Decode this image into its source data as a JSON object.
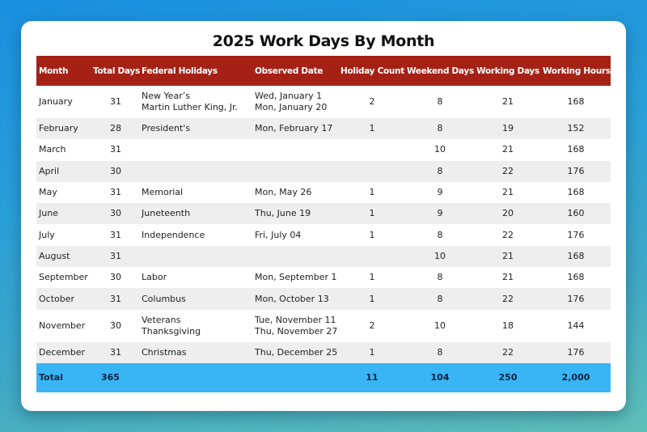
{
  "title": "2025 Work Days By Month",
  "colors": {
    "header_bg": "#a52116",
    "total_bg": "#39b5f5",
    "stripe_bg": "#eeeeee"
  },
  "columns": [
    "Month",
    "Total Days",
    "Federal Holidays",
    "Observed Date",
    "Holiday Count",
    "Weekend Days",
    "Working Days",
    "Working Hours"
  ],
  "rows": [
    {
      "month": "January",
      "total_days": "31",
      "holidays": [
        "New Year’s",
        "Martin Luther King, Jr."
      ],
      "dates": [
        "Wed, January 1",
        "Mon, January 20"
      ],
      "holiday_count": "2",
      "weekend_days": "8",
      "working_days": "21",
      "working_hours": "168"
    },
    {
      "month": "February",
      "total_days": "28",
      "holidays": [
        "President's"
      ],
      "dates": [
        "Mon, February 17"
      ],
      "holiday_count": "1",
      "weekend_days": "8",
      "working_days": "19",
      "working_hours": "152"
    },
    {
      "month": "March",
      "total_days": "31",
      "holidays": [],
      "dates": [],
      "holiday_count": "",
      "weekend_days": "10",
      "working_days": "21",
      "working_hours": "168"
    },
    {
      "month": "April",
      "total_days": "30",
      "holidays": [],
      "dates": [],
      "holiday_count": "",
      "weekend_days": "8",
      "working_days": "22",
      "working_hours": "176"
    },
    {
      "month": "May",
      "total_days": "31",
      "holidays": [
        "Memorial"
      ],
      "dates": [
        "Mon, May 26"
      ],
      "holiday_count": "1",
      "weekend_days": "9",
      "working_days": "21",
      "working_hours": "168"
    },
    {
      "month": "June",
      "total_days": "30",
      "holidays": [
        "Juneteenth"
      ],
      "dates": [
        "Thu, June 19"
      ],
      "holiday_count": "1",
      "weekend_days": "9",
      "working_days": "20",
      "working_hours": "160"
    },
    {
      "month": "July",
      "total_days": "31",
      "holidays": [
        "Independence"
      ],
      "dates": [
        "Fri, July 04"
      ],
      "holiday_count": "1",
      "weekend_days": "8",
      "working_days": "22",
      "working_hours": "176"
    },
    {
      "month": "August",
      "total_days": "31",
      "holidays": [],
      "dates": [],
      "holiday_count": "",
      "weekend_days": "10",
      "working_days": "21",
      "working_hours": "168"
    },
    {
      "month": "September",
      "total_days": "30",
      "holidays": [
        "Labor"
      ],
      "dates": [
        "Mon, September 1"
      ],
      "holiday_count": "1",
      "weekend_days": "8",
      "working_days": "21",
      "working_hours": "168"
    },
    {
      "month": "October",
      "total_days": "31",
      "holidays": [
        "Columbus"
      ],
      "dates": [
        "Mon, October 13"
      ],
      "holiday_count": "1",
      "weekend_days": "8",
      "working_days": "22",
      "working_hours": "176"
    },
    {
      "month": "November",
      "total_days": "30",
      "holidays": [
        "Veterans",
        "Thanksgiving"
      ],
      "dates": [
        "Tue, November 11",
        "Thu, November 27"
      ],
      "holiday_count": "2",
      "weekend_days": "10",
      "working_days": "18",
      "working_hours": "144"
    },
    {
      "month": "December",
      "total_days": "31",
      "holidays": [
        "Christmas"
      ],
      "dates": [
        "Thu, December 25"
      ],
      "holiday_count": "1",
      "weekend_days": "8",
      "working_days": "22",
      "working_hours": "176"
    }
  ],
  "total": {
    "label": "Total",
    "total_days": "365",
    "holiday_count": "11",
    "weekend_days": "104",
    "working_days": "250",
    "working_hours": "2,000"
  }
}
